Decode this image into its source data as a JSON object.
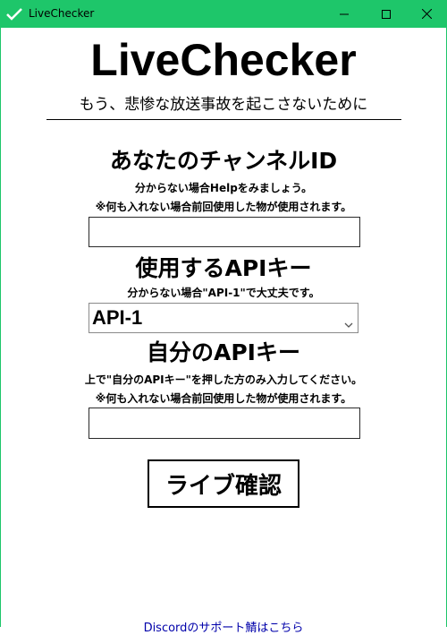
{
  "window": {
    "title": "LiveChecker",
    "icon": "check-icon",
    "accent": "#1ec66a"
  },
  "header": {
    "title": "LiveChecker",
    "subtitle": "もう、悲惨な放送事故を起こさないために"
  },
  "channel": {
    "title": "あなたのチャンネルID",
    "note1": "分からない場合Helpをみましょう。",
    "note2": "※何も入れない場合前回使用した物が使用されます。",
    "value": ""
  },
  "api_select": {
    "title": "使用するAPIキー",
    "note": "分からない場合\"API-1\"で大丈夫です。",
    "selected": "API-1"
  },
  "own_api": {
    "title": "自分のAPIキー",
    "note1": "上で\"自分のAPIキー\"を押した方のみ入力してください。",
    "note2": "※何も入れない場合前回使用した物が使用されます。",
    "value": ""
  },
  "actions": {
    "check_label": "ライブ確認"
  },
  "footer": {
    "link": "Discordのサポート鯖はこちら"
  }
}
